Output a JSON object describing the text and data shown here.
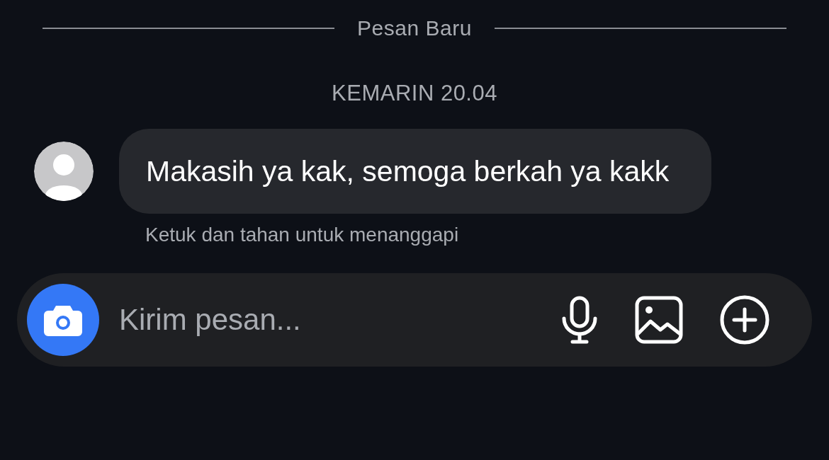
{
  "divider": {
    "label": "Pesan Baru"
  },
  "timestamp": "KEMARIN 20.04",
  "message": {
    "text": "Makasih ya kak, semoga berkah ya kakk",
    "hint": "Ketuk dan tahan untuk menanggapi"
  },
  "composer": {
    "placeholder": "Kirim pesan..."
  }
}
